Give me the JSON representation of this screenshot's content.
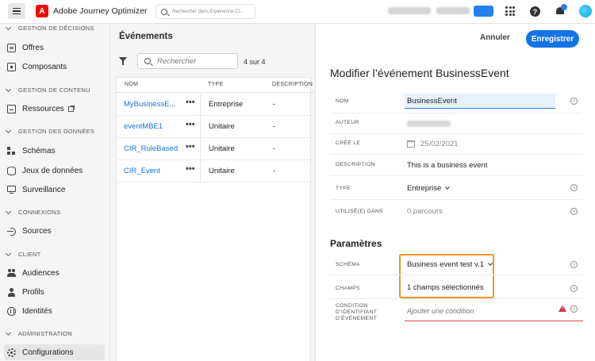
{
  "header": {
    "logo_letter": "A",
    "app_title": "Adobe Journey Optimizer",
    "search_placeholder": "Rechercher dans Experience Cl..."
  },
  "sidebar": {
    "sections": [
      {
        "label": "GESTION DE DÉCISIONS"
      },
      {
        "label": "GESTION DE CONTENU"
      },
      {
        "label": "GESTION DES DONNÉES"
      },
      {
        "label": "CONNEXIONS"
      },
      {
        "label": "CLIENT"
      },
      {
        "label": "ADMINISTRATION"
      }
    ],
    "items": [
      {
        "label": "Offres",
        "icon": "offers-icon"
      },
      {
        "label": "Composants",
        "icon": "components-icon"
      },
      {
        "label": "Ressources",
        "icon": "assets-icon"
      },
      {
        "label": "Schémas",
        "icon": "schema-icon"
      },
      {
        "label": "Jeux de données",
        "icon": "dataset-icon"
      },
      {
        "label": "Surveillance",
        "icon": "monitor-icon"
      },
      {
        "label": "Sources",
        "icon": "sources-icon"
      },
      {
        "label": "Audiences",
        "icon": "audiences-icon"
      },
      {
        "label": "Profils",
        "icon": "profile-icon"
      },
      {
        "label": "Identités",
        "icon": "identity-icon"
      },
      {
        "label": "Configurations",
        "icon": "settings-icon"
      }
    ]
  },
  "events": {
    "title": "Événements",
    "search_placeholder": "Rechercher",
    "count": "4 sur 4",
    "columns": [
      "NOM",
      "TYPE",
      "DESCRIPTION"
    ],
    "rows": [
      {
        "name": "MyBusinessE...",
        "more": "•••",
        "type": "Entreprise",
        "description": "-"
      },
      {
        "name": "eventMBE1",
        "more": "•••",
        "type": "Unitaire",
        "description": "-"
      },
      {
        "name": "CIR_RuleBased",
        "more": "•••",
        "type": "Unitaire",
        "description": "-"
      },
      {
        "name": "CIR_Event",
        "more": "•••",
        "type": "Unitaire",
        "description": "-"
      }
    ]
  },
  "panel": {
    "cancel_label": "Annuler",
    "save_label": "Enregistrer",
    "title": "Modifier l’événement BusinessEvent",
    "fields": {
      "name_label": "NOM",
      "name_value": "BusinessEvent",
      "author_label": "AUTEUR",
      "created_label": "CRÉÉ LE",
      "created_value": "25/02/2021",
      "description_label": "DESCRIPTION",
      "description_value": "This is a business event",
      "type_label": "TYPE",
      "type_value": "Entreprise",
      "used_label": "UTILISÉ(E) DANS",
      "used_value": "0 parcours"
    },
    "params_title": "Paramètres",
    "params": {
      "schema_label": "SCHÉMA",
      "schema_value": "Business event test v.1",
      "fields_label": "CHAMPS",
      "fields_value": "1 champs sélectionnés",
      "condition_label_1": "CONDITION",
      "condition_label_2": "D’IDENTIFIANT",
      "condition_label_3": "D’ÉVÉNEMENT",
      "condition_placeholder": "Ajouter une condition"
    },
    "info_glyph": "i"
  },
  "colors": {
    "accent": "#1473e6",
    "highlight": "#f29423",
    "error": "#d7373f"
  }
}
